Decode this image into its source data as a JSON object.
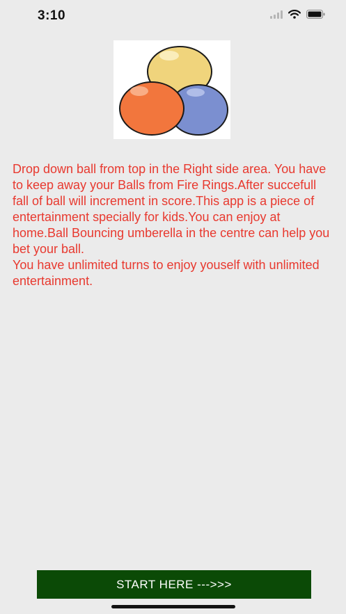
{
  "status_bar": {
    "time": "3:10"
  },
  "logo": {
    "icon": "colored-balls-icon",
    "ball_colors": [
      "#f0d47c",
      "#7b8fd0",
      "#f2763d"
    ]
  },
  "description": {
    "text": "Drop down ball from top in the Right side area. You have to keep away your Balls from Fire Rings.After succefull fall of ball will increment in score.This app is a piece of entertainment specially for kids.You can enjoy at home.Ball Bouncing umberella in the centre can help you bet your ball.\nYou have unlimited turns to enjoy youself with unlimited entertainment.",
    "color": "#e8392f"
  },
  "start_button": {
    "label": "START HERE --->>>",
    "color": "#0b4a06"
  }
}
